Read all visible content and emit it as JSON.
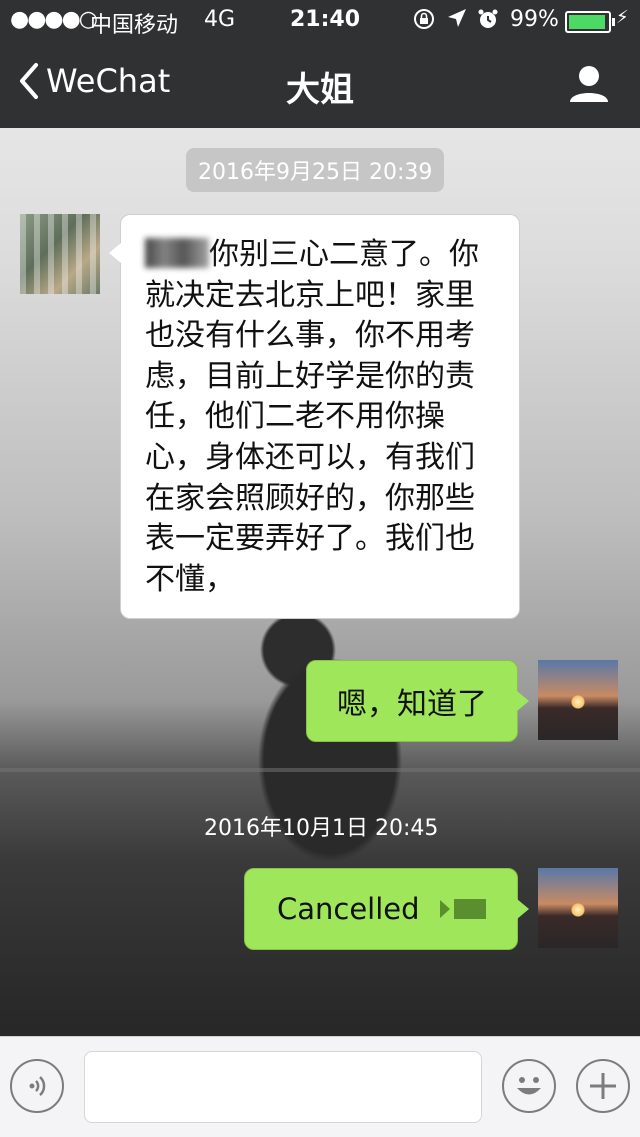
{
  "status_bar": {
    "signal": "●●●●○",
    "carrier": "中国移动",
    "network": "4G",
    "time": "21:40",
    "battery": "99%",
    "icons": [
      "orientation-lock-icon",
      "location-icon",
      "alarm-icon",
      "battery-icon",
      "charging-bolt-icon"
    ]
  },
  "nav": {
    "back_label": "WeChat",
    "title": "大姐",
    "icons": [
      "chevron-left-icon",
      "profile-icon"
    ]
  },
  "messages": {
    "timestamp_1": "2016年9月25日 20:39",
    "incoming_text": "你别三心二意了。你就决定去北京上吧！家里也没有什么事，你不用考虑，目前上好学是你的责任，他们二老不用你操心，身体还可以，有我们在家会照顾好的，你那些表一定要弄好了。我们也不懂，",
    "reply_1": "嗯，知道了",
    "timestamp_2": "2016年10月1日 20:45",
    "reply_2": "Cancelled"
  },
  "input_bar": {
    "icons": [
      "voice-icon",
      "emoji-icon",
      "plus-icon"
    ]
  },
  "colors": {
    "bar": "#2f3133",
    "outgoing_bubble": "#9fe65b",
    "incoming_bubble": "#ffffff",
    "battery_fill": "#4cd964"
  }
}
